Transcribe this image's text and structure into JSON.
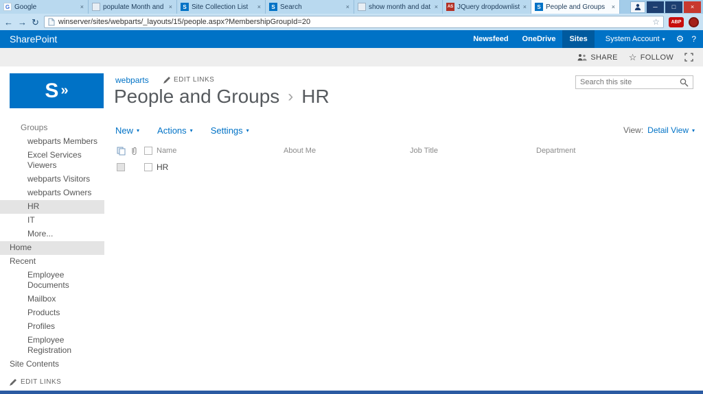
{
  "icons": {
    "close": "×",
    "minimize": "─",
    "maximize": "□",
    "back": "←",
    "forward": "→",
    "refresh": "↻",
    "star": "☆",
    "gear": "⚙",
    "caret": "▾",
    "title_sep": "›",
    "follow_star": "☆",
    "google_letter": "G",
    "sharepoint_letter": "S",
    "aspsnippets_letters": "AS",
    "logo_s": "S",
    "logo_chevron": "»"
  },
  "browser": {
    "tabs": [
      {
        "label": "Google",
        "icon": "google-icon"
      },
      {
        "label": "populate Month and",
        "icon": "page-icon"
      },
      {
        "label": "Site Collection List",
        "icon": "sharepoint-icon"
      },
      {
        "label": "Search",
        "icon": "sharepoint-icon"
      },
      {
        "label": "show month and dat",
        "icon": "page-icon"
      },
      {
        "label": "JQuery dropdownlist",
        "icon": "aspsnippets-icon"
      },
      {
        "label": "People and Groups",
        "icon": "sharepoint-icon"
      }
    ],
    "url": "winserver/sites/webparts/_layouts/15/people.aspx?MembershipGroupId=20",
    "abp_label": "ABP"
  },
  "suitebar": {
    "brand": "SharePoint",
    "newsfeed": "Newsfeed",
    "onedrive": "OneDrive",
    "sites": "Sites",
    "account": "System Account",
    "help": "?"
  },
  "ribbon": {
    "share": "SHARE",
    "follow": "FOLLOW"
  },
  "page": {
    "breadcrumb": "webparts",
    "edit_links": "EDIT LINKS",
    "title": "People and Groups",
    "subtitle": "HR",
    "search_placeholder": "Search this site"
  },
  "sidebar": {
    "groups_header": "Groups",
    "group_items": [
      "webparts Members",
      "Excel Services Viewers",
      "webparts Visitors",
      "webparts Owners",
      "HR",
      "IT",
      "More..."
    ],
    "home": "Home",
    "recent_header": "Recent",
    "recent_items": [
      "Employee Documents",
      "Mailbox",
      "Products",
      "Profiles",
      "Employee Registration"
    ],
    "site_contents": "Site Contents",
    "edit_links": "EDIT LINKS"
  },
  "toolbar": {
    "new": "New",
    "actions": "Actions",
    "settings": "Settings",
    "view_label": "View:",
    "view_value": "Detail View"
  },
  "table": {
    "columns": [
      "Name",
      "About Me",
      "Job Title",
      "Department"
    ],
    "rows": [
      {
        "name": "HR"
      }
    ]
  }
}
